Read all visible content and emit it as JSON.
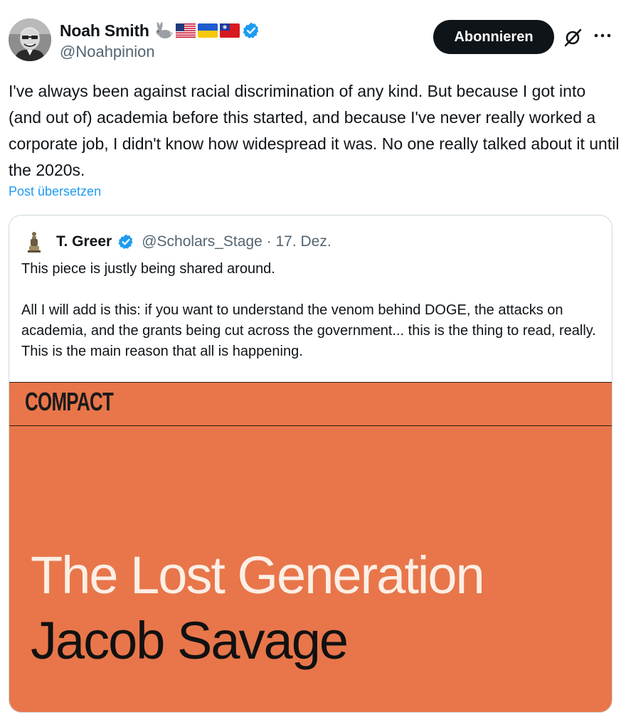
{
  "author": {
    "display_name": "Noah Smith",
    "handle": "@Noahpinion",
    "emoji": [
      "rabbit",
      "flag-us",
      "flag-ua",
      "flag-tw"
    ],
    "verified": true
  },
  "header": {
    "follow_label": "Abonnieren"
  },
  "post": {
    "text": "I've always been against racial discrimination of any kind. But because I got into (and out of) academia before this started, and because I've never really worked a corporate job, I didn't know how widespread it was. No one really talked about it until the 2020s.",
    "translate_label": "Post übersetzen"
  },
  "quote": {
    "display_name": "T. Greer",
    "handle_date": "@Scholars_Stage · 17. Dez.",
    "verified": true,
    "paragraphs": [
      "This piece is justly being shared around.",
      "All I will add is this: if you want to understand the venom behind DOGE, the attacks on academia, and the grants being cut across the government... this is the thing to read, really. This is the main reason that all is happening."
    ],
    "media": {
      "brand": "COMPACT",
      "title": "The Lost Generation",
      "author": "Jacob Savage",
      "background": "#e8764a"
    }
  },
  "colors": {
    "text": "#0f1419",
    "secondary": "#536471",
    "link": "#1d9bf0",
    "verified": "#1d9bf0",
    "button_bg": "#0f1419"
  }
}
